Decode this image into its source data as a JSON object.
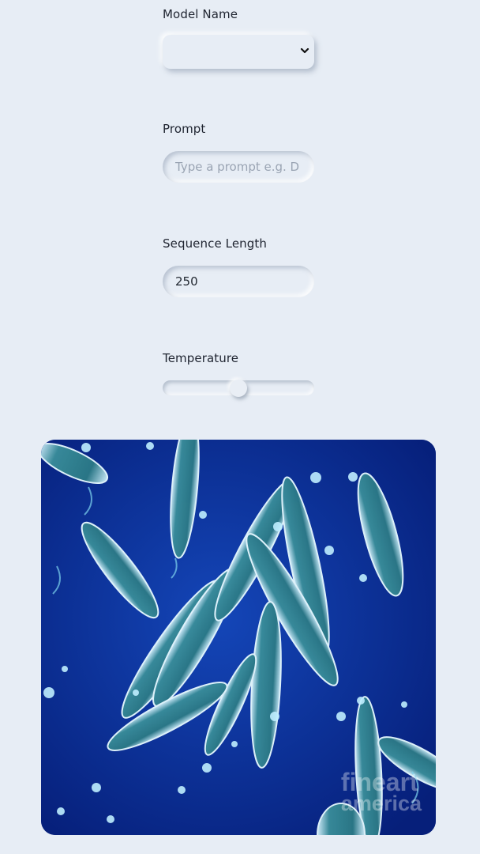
{
  "form": {
    "model_name": {
      "label": "Model Name",
      "selected": ""
    },
    "prompt": {
      "label": "Prompt",
      "placeholder": "Type a prompt e.g. D",
      "value": ""
    },
    "sequence_length": {
      "label": "Sequence Length",
      "value": "250"
    },
    "temperature": {
      "label": "Temperature",
      "level": 0.5
    }
  },
  "image": {
    "watermark_line1": "fineart",
    "watermark_line2": "america"
  },
  "colors": {
    "background": "#e7edf5",
    "image_bg": "#0a2a8a"
  }
}
